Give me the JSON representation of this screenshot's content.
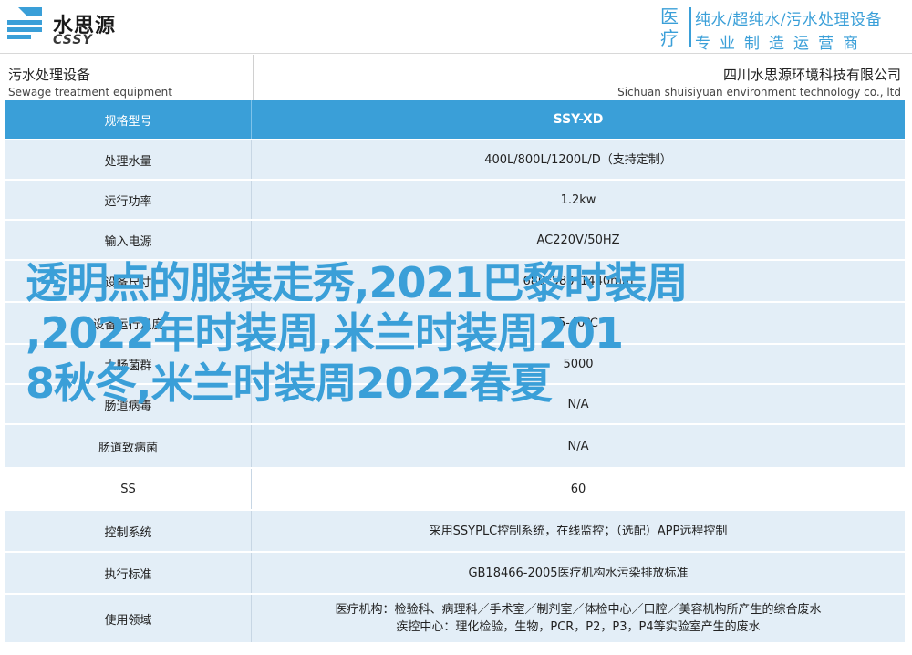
{
  "header": {
    "logo_cn": "水思源",
    "logo_en": "CSSY",
    "badge": "医疗",
    "slogan_line1": "纯水/超纯水/污水处理设备",
    "slogan_line2": "专业制造运营商"
  },
  "subheader": {
    "left_cn": "污水处理设备",
    "left_en": "Sewage treatment equipment",
    "right_cn": "四川水思源环境科技有限公司",
    "right_en": "Sichuan shuisiyuan environment technology co., ltd"
  },
  "table": {
    "header": {
      "key": "规格型号",
      "value": "SSY-XD"
    },
    "rows": [
      {
        "key": "处理水量",
        "value": "400L/800L/1200L/D（支持定制）"
      },
      {
        "key": "运行功率",
        "value": "1.2kw"
      },
      {
        "key": "输入电源",
        "value": "AC220V/50HZ"
      },
      {
        "key": "设备尺寸",
        "value": "680*580*1440mm"
      },
      {
        "key": "设备运行温度",
        "value": "5-40℃"
      },
      {
        "key": "大肠菌群",
        "value": "5000"
      },
      {
        "key": "肠道病毒",
        "value": "N/A"
      },
      {
        "key": "肠道致病菌",
        "value": "N/A"
      },
      {
        "key": "SS",
        "value": "60"
      },
      {
        "key": "控制系统",
        "value": "采用SSYPLC控制系统，在线监控；（选配）APP远程控制"
      },
      {
        "key": "执行标准",
        "value": "GB18466-2005医疗机构水污染排放标准"
      },
      {
        "key": "使用领域",
        "value": "医疗机构：检验科、病理科／手术室／制剂室／体检中心／口腔／美容机构所产生的综合废水",
        "value2": "疾控中心：理化检验，生物，PCR，P2，P3，P4等实验室产生的废水"
      }
    ]
  },
  "overlay": {
    "text": "透明点的服装走秀,2021巴黎时装周\n,2022年时装周,米兰时装周201\n    8秋冬,米兰时装周2022春夏"
  },
  "colors": {
    "accent": "#3a9fd8",
    "row_alt": "#e3eef7"
  }
}
